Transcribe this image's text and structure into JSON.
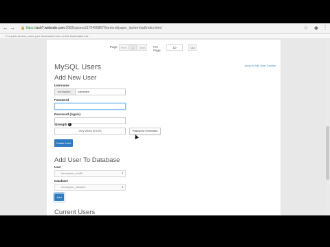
{
  "browser": {
    "back": "←",
    "forward": "→",
    "lock": "🔒",
    "url_scheme": "https://",
    "url_host": "ash7.webvale.com",
    "url_path": ":2083/cpsess1175496867/frontend/paper_lantern/sql/index.html",
    "infobar_text": "For quick access, place your bookmarks here on the bookmarks bar."
  },
  "pager": {
    "page_label": "Page:",
    "prev": "Prev",
    "current": "1",
    "next": "Next",
    "per_page_label": "Per Page:",
    "per_page_value": "10",
    "go": "Go"
  },
  "page": {
    "title": "MySQL Users",
    "top_link": "Jump to Add User Section",
    "add_user": {
      "heading": "Add New User",
      "username_label": "Username",
      "username_prefix": "hemispher_",
      "username_value": "rosemare",
      "password_label": "Password",
      "password_again_label": "Password (Again)",
      "strength_label": "Strength",
      "strength_value": "Very Weak (0/100)",
      "generator_button": "Password Generator",
      "create_button": "Create User"
    },
    "add_to_db": {
      "heading": "Add User To Database",
      "user_label": "User",
      "user_value": "hemispher_wm8k",
      "database_label": "Database",
      "database_value": "hemispher_wfsstore",
      "add_button": "Add"
    },
    "current_users_heading": "Current Users"
  }
}
